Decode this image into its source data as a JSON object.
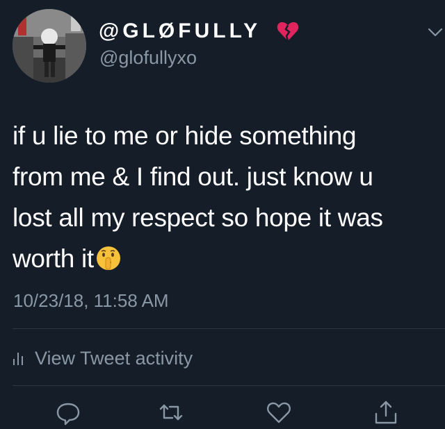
{
  "user": {
    "display_name": "@GLØFULLY",
    "handle": "@glofullyxo",
    "name_emoji": "broken-heart-icon"
  },
  "tweet": {
    "lines": [
      "if u lie to me or hide something",
      "from me & I find out. just know u",
      "lost all my respect so hope it was",
      "worth it"
    ],
    "trailing_emoji": "shushing-face-icon",
    "timestamp": "10/23/18, 11:58 AM"
  },
  "activity": {
    "label": "View Tweet activity",
    "icon": "bar-chart-icon"
  },
  "actions": [
    {
      "name": "reply",
      "icon": "reply-icon"
    },
    {
      "name": "retweet",
      "icon": "retweet-icon"
    },
    {
      "name": "like",
      "icon": "heart-outline-icon"
    },
    {
      "name": "share",
      "icon": "share-icon"
    }
  ],
  "colors": {
    "background": "#151d28",
    "text": "#ffffff",
    "secondary_text": "#8a98a6",
    "divider": "#2c3846",
    "broken_heart": "#e0245e"
  }
}
